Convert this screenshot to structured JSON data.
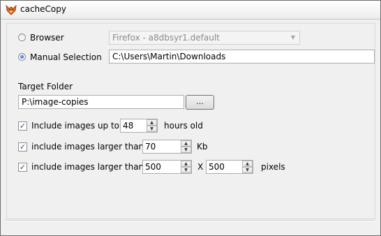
{
  "window": {
    "title": "cacheCopy"
  },
  "source": {
    "browser_label": "Browser",
    "browser_value": "Firefox - a8dbsyr1.default",
    "manual_label": "Manual Selection",
    "manual_value": "C:\\Users\\Martin\\Downloads",
    "selected": "manual"
  },
  "target": {
    "label": "Target Folder",
    "value": "P:\\image-copies",
    "browse_label": "..."
  },
  "options": {
    "age": {
      "label": "Include images up to",
      "value": "48",
      "suffix": "hours old",
      "checked": true
    },
    "size": {
      "label": "include images larger than",
      "value": "70",
      "suffix": "Kb",
      "checked": true
    },
    "dims": {
      "label": "include images larger than",
      "width": "500",
      "x_label": "X",
      "height": "500",
      "suffix": "pixels",
      "checked": true
    }
  },
  "glyphs": {
    "check": "✓",
    "up": "▲",
    "down": "▼",
    "combo": "▼"
  },
  "icons": {
    "app": "fox-app-icon"
  }
}
